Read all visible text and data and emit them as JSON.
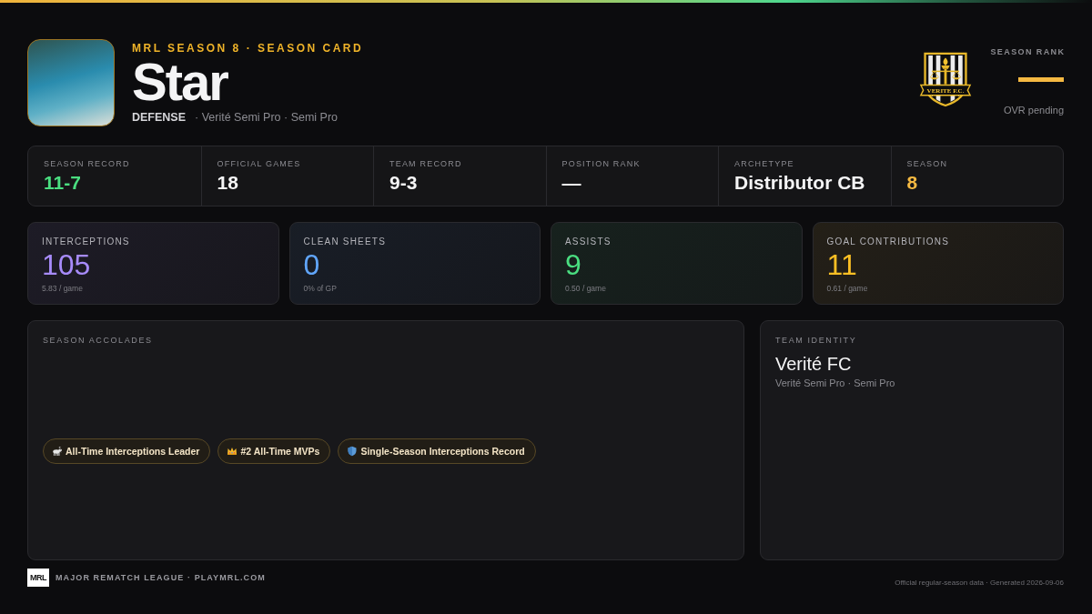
{
  "header": {
    "eyebrow": "MRL SEASON 8 · SEASON CARD",
    "player_name": "Star",
    "position": "DEFENSE",
    "team_line": "· Verité Semi Pro · Semi Pro",
    "crest_text": "VERITE F.C."
  },
  "season_rank": {
    "label": "SEASON RANK",
    "value": "—",
    "note": "OVR pending"
  },
  "summary": [
    {
      "label": "SEASON RECORD",
      "value": "11-7",
      "color": "#4ade80"
    },
    {
      "label": "OFFICIAL GAMES",
      "value": "18",
      "color": "#f4f4f5"
    },
    {
      "label": "TEAM RECORD",
      "value": "9-3",
      "color": "#f4f4f5"
    },
    {
      "label": "POSITION RANK",
      "value": "—",
      "color": "#f4f4f5"
    },
    {
      "label": "ARCHETYPE",
      "value": "Distributor CB",
      "color": "#f4f4f5"
    },
    {
      "label": "SEASON",
      "value": "8",
      "color": "#f5b942"
    }
  ],
  "stat_cards": [
    {
      "label": "INTERCEPTIONS",
      "value": "105",
      "detail": "5.83 / game",
      "color": "#a78bfa"
    },
    {
      "label": "CLEAN SHEETS",
      "value": "0",
      "detail": "0% of GP",
      "color": "#60a5fa"
    },
    {
      "label": "ASSISTS",
      "value": "9",
      "detail": "0.50 / game",
      "color": "#4ade80"
    },
    {
      "label": "GOAL CONTRIBUTIONS",
      "value": "11",
      "detail": "0.61 / game",
      "color": "#fbbf24"
    }
  ],
  "accolades": {
    "title": "SEASON ACCOLADES",
    "items": [
      {
        "kind": "goat",
        "label": "All-Time Interceptions Leader"
      },
      {
        "kind": "crown",
        "label": "#2 All-Time MVPs"
      },
      {
        "kind": "shield",
        "label": "Single-Season Interceptions Record"
      }
    ]
  },
  "team_identity": {
    "title": "TEAM IDENTITY",
    "name": "Verité FC",
    "detail": "Verité Semi Pro · Semi Pro"
  },
  "footer": {
    "logo_text": "MRL",
    "league": "MAJOR REMATCH LEAGUE · PLAYMRL.COM",
    "note": "Official regular-season data · Generated 2026-09-06"
  }
}
